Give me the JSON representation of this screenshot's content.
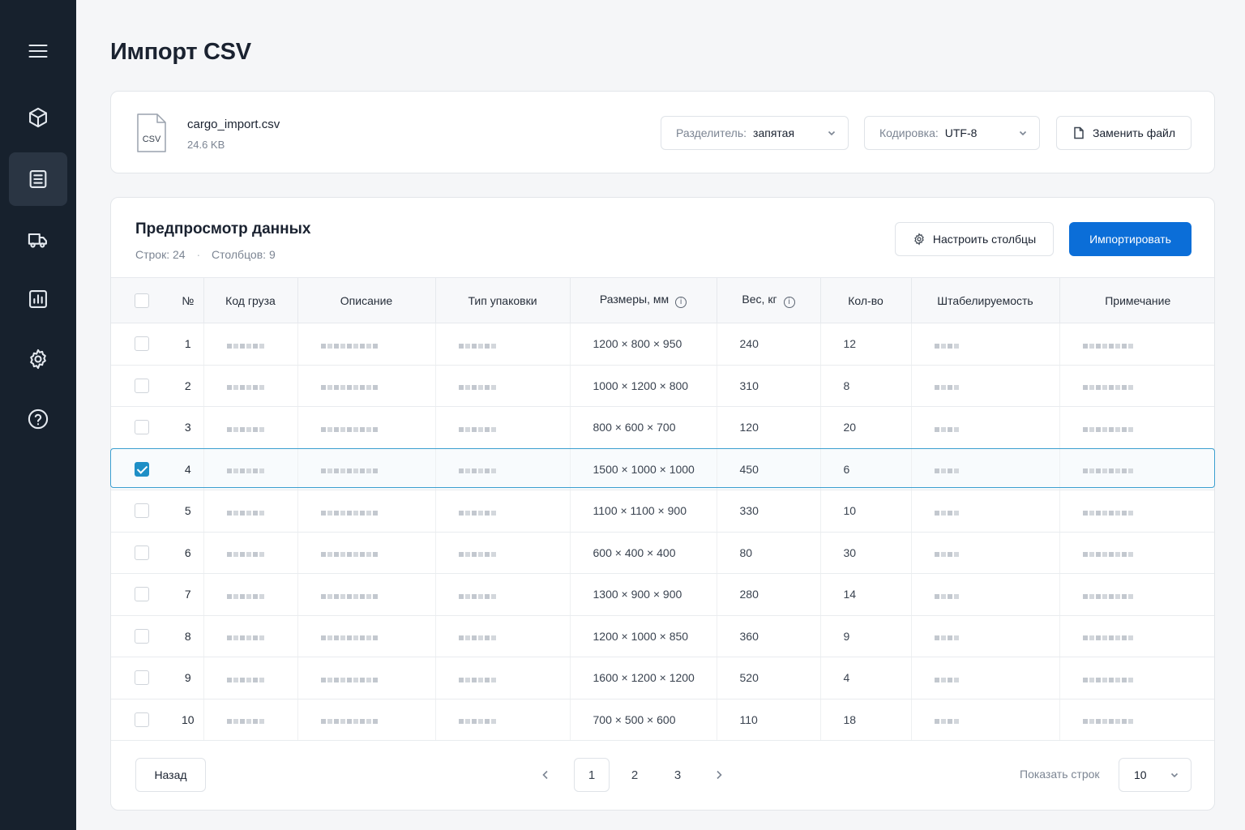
{
  "page": {
    "title": "Импорт CSV"
  },
  "sidebar": {
    "items": [
      {
        "icon": "menu-icon"
      },
      {
        "icon": "box-icon"
      },
      {
        "icon": "list-icon",
        "active": true
      },
      {
        "icon": "truck-icon"
      },
      {
        "icon": "chart-icon"
      },
      {
        "icon": "gear-icon"
      },
      {
        "icon": "help-icon"
      }
    ]
  },
  "file": {
    "icon_label": "CSV",
    "name": "cargo_import.csv",
    "size": "24.6 KB",
    "delimiter_label": "Разделитель:",
    "delimiter_value": "запятая",
    "encoding_label": "Кодировка:",
    "encoding_value": "UTF-8",
    "replace_label": "Заменить файл"
  },
  "preview": {
    "title": "Предпросмотр данных",
    "rows_label": "Строк:",
    "rows_value": "24",
    "cols_label": "Столбцов:",
    "cols_value": "9",
    "configure_label": "Настроить столбцы",
    "import_label": "Импортировать"
  },
  "table": {
    "headers": {
      "num": "№",
      "code": "Код груза",
      "desc": "Описание",
      "pack": "Тип упаковки",
      "dims": "Размеры, мм",
      "weight": "Вес, кг",
      "qty": "Кол-во",
      "stack": "Штабелируемость",
      "note": "Примечание"
    },
    "rows": [
      {
        "num": "1",
        "dims": "1200 × 800 × 950",
        "weight": "240",
        "qty": "12",
        "checked": false
      },
      {
        "num": "2",
        "dims": "1000 × 1200 × 800",
        "weight": "310",
        "qty": "8",
        "checked": false
      },
      {
        "num": "3",
        "dims": "800 × 600 × 700",
        "weight": "120",
        "qty": "20",
        "checked": false
      },
      {
        "num": "4",
        "dims": "1500 × 1000 × 1000",
        "weight": "450",
        "qty": "6",
        "checked": true
      },
      {
        "num": "5",
        "dims": "1100 × 1100 × 900",
        "weight": "330",
        "qty": "10",
        "checked": false
      },
      {
        "num": "6",
        "dims": "600 × 400 × 400",
        "weight": "80",
        "qty": "30",
        "checked": false
      },
      {
        "num": "7",
        "dims": "1300 × 900 × 900",
        "weight": "280",
        "qty": "14",
        "checked": false
      },
      {
        "num": "8",
        "dims": "1200 × 1000 × 850",
        "weight": "360",
        "qty": "9",
        "checked": false
      },
      {
        "num": "9",
        "dims": "1600 × 1200 × 1200",
        "weight": "520",
        "qty": "4",
        "checked": false
      },
      {
        "num": "10",
        "dims": "700 × 500 × 600",
        "weight": "110",
        "qty": "18",
        "checked": false
      }
    ]
  },
  "pagination": {
    "back_label": "Назад",
    "pages": [
      "1",
      "2",
      "3"
    ],
    "current": "1",
    "rows_per_page_label": "Показать строк",
    "rows_per_page_value": "10"
  },
  "colors": {
    "accent": "#0b6ed8",
    "sidebar": "#17212d",
    "selected_border": "#3b9fd0"
  }
}
